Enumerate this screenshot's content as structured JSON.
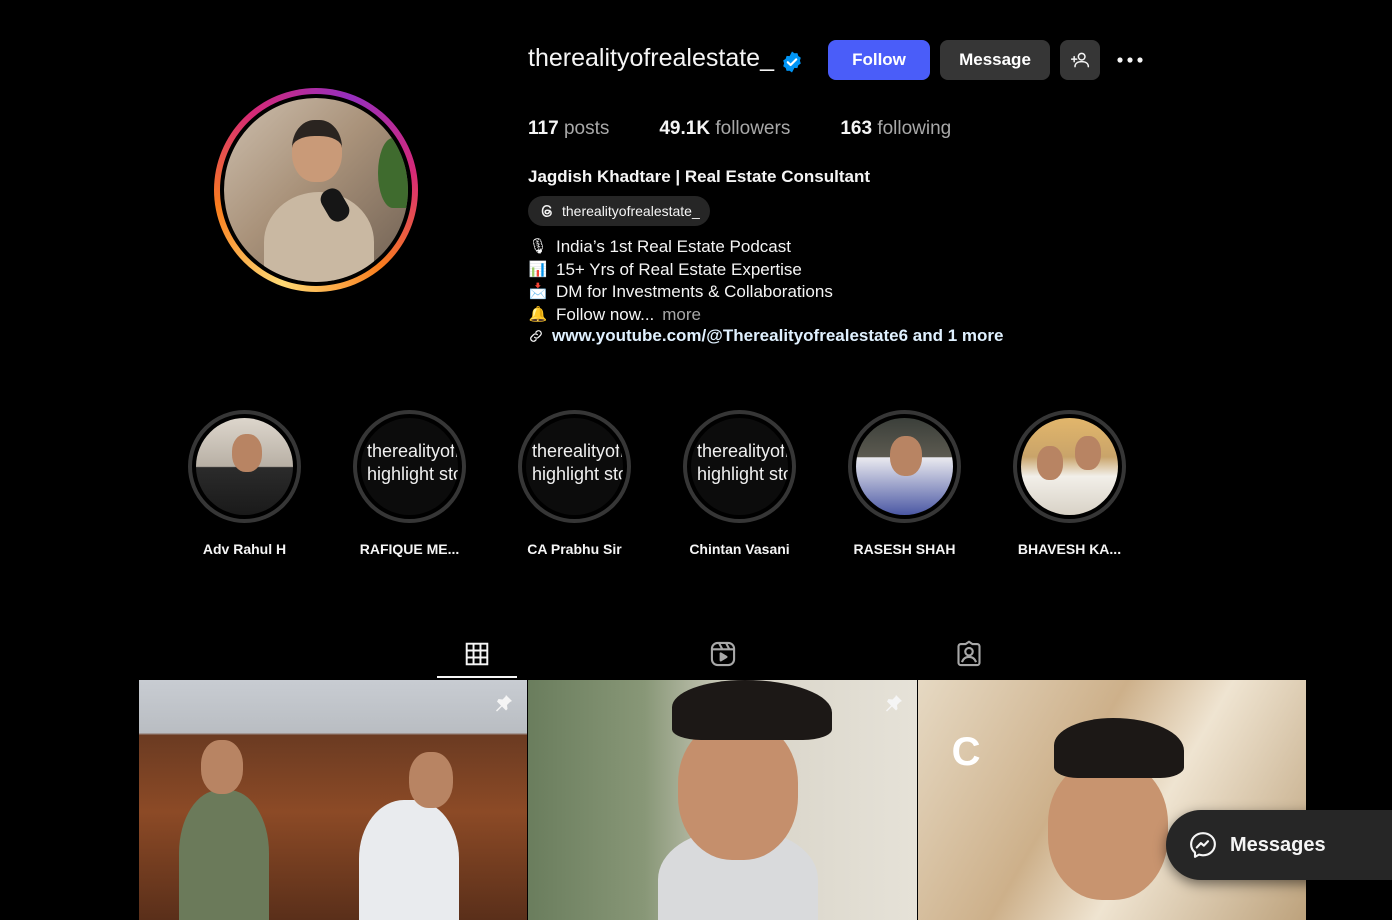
{
  "profile": {
    "username": "therealityofrealestate_",
    "follow_label": "Follow",
    "message_label": "Message",
    "stats": {
      "posts_count": "117",
      "posts_label": "posts",
      "followers_count": "49.1K",
      "followers_label": "followers",
      "following_count": "163",
      "following_label": "following"
    },
    "full_name": "Jagdish Khadtare | Real Estate Consultant",
    "threads_handle": "therealityofrealestate_",
    "bio": [
      {
        "emoji": "🎙",
        "text": "India’s 1st Real Estate Podcast"
      },
      {
        "emoji": "📊",
        "text": "15+ Yrs of Real Estate Expertise"
      },
      {
        "emoji": "📩",
        "text": "DM for Investments & Collaborations"
      },
      {
        "emoji": "🔔",
        "text": "Follow now..."
      }
    ],
    "bio_more": "more",
    "link": "www.youtube.com/@Therealityofrealestate6 and 1 more"
  },
  "highlights": [
    {
      "label": "Adv Rahul H",
      "cover_text_1": "",
      "cover_text_2": ""
    },
    {
      "label": "RAFIQUE ME...",
      "cover_text_1": "therealityofr",
      "cover_text_2": "highlight sto"
    },
    {
      "label": "CA Prabhu Sir",
      "cover_text_1": "therealityofr",
      "cover_text_2": "highlight sto"
    },
    {
      "label": "Chintan Vasani",
      "cover_text_1": "therealityofr",
      "cover_text_2": "highlight sto"
    },
    {
      "label": "RASESH SHAH",
      "cover_text_1": "",
      "cover_text_2": ""
    },
    {
      "label": "BHAVESH KA...",
      "cover_text_1": "",
      "cover_text_2": ""
    }
  ],
  "tabs": [
    {
      "icon": "grid-icon",
      "active": true
    },
    {
      "icon": "reels-icon",
      "active": false
    },
    {
      "icon": "tagged-icon",
      "active": false
    }
  ],
  "posts": [
    {
      "pinned": true
    },
    {
      "pinned": true
    },
    {
      "pinned": false,
      "logo": "C"
    }
  ],
  "messages": {
    "label": "Messages"
  },
  "colors": {
    "background": "#000000",
    "follow_button": "#4a5df9",
    "secondary_button": "#363636",
    "verified": "#0095f6",
    "muted_text": "#a8a8a8",
    "link_text": "#e0f1ff"
  }
}
